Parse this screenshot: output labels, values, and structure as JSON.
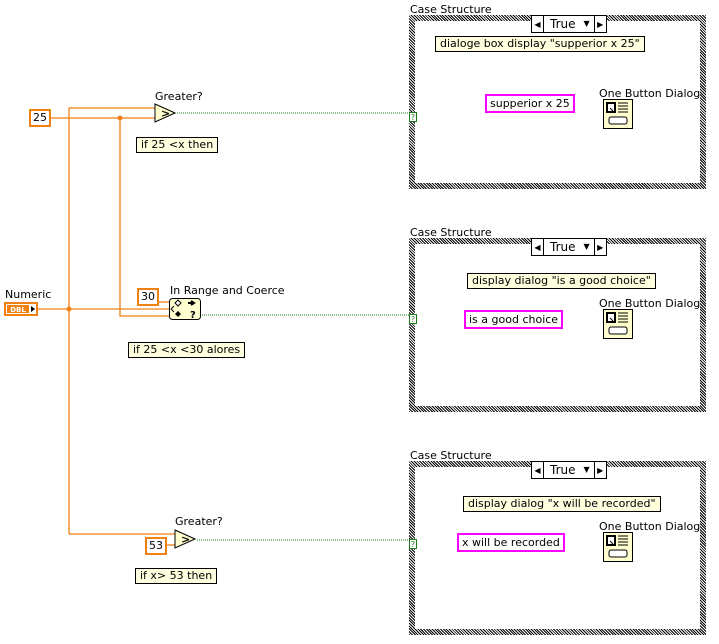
{
  "diagram": {
    "control": {
      "label": "Numeric",
      "type": "DBL"
    },
    "constants": [
      "25",
      "30",
      "53"
    ],
    "nodes": {
      "greater1": {
        "label": "Greater?"
      },
      "in_range": {
        "label": "In Range and Coerce"
      },
      "greater2": {
        "label": "Greater?"
      }
    },
    "comments": [
      "if 25 <x then",
      "if 25 <x <30 alores",
      "if x> 53 then"
    ],
    "cases": [
      {
        "label": "Case Structure",
        "selector": "True",
        "comment": "dialoge box display \"supperior x 25\"",
        "string_constant": "supperior x 25",
        "function_label": "One Button Dialog"
      },
      {
        "label": "Case Structure",
        "selector": "True",
        "comment": "display dialog \"is a good choice\"",
        "string_constant": "is a good choice",
        "function_label": "One Button Dialog"
      },
      {
        "label": "Case Structure",
        "selector": "True",
        "comment": "display dialog \"x will be recorded\"",
        "string_constant": "x will be recorded",
        "function_label": "One Button Dialog"
      }
    ],
    "tunnel_glyph": "?",
    "colors": {
      "numeric_wire": "#f08010",
      "boolean_wire": "#1a7a1a",
      "string_wire": "#ff00ff",
      "comment_bg": "#ffffe0",
      "node_bg": "#ffffd0"
    }
  }
}
